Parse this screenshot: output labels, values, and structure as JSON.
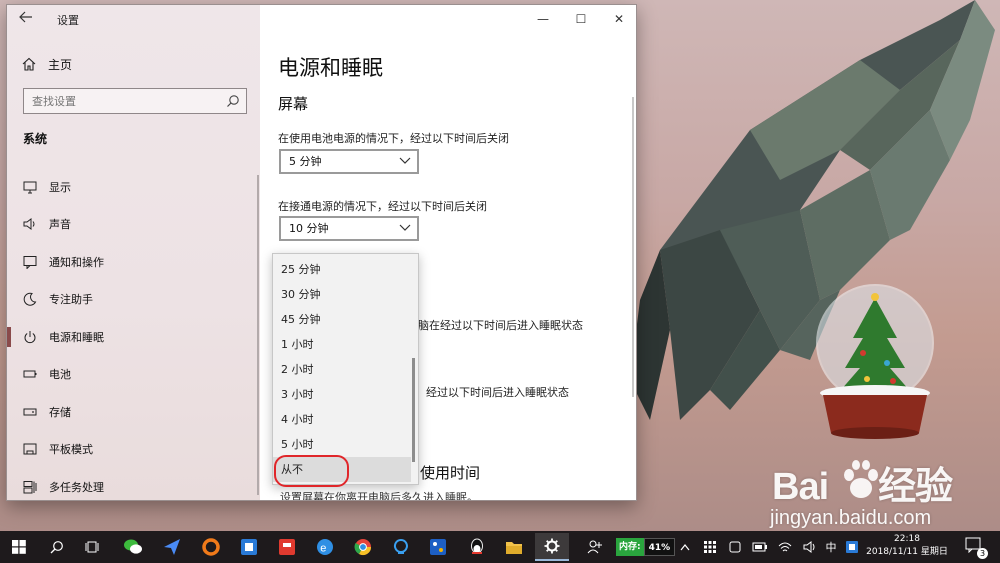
{
  "window": {
    "title": "设置",
    "controls": {
      "minimize": "—",
      "maximize": "☐",
      "close": "✕"
    }
  },
  "sidebar": {
    "home_label": "主页",
    "search_placeholder": "查找设置",
    "section_title": "系统",
    "items": [
      {
        "label": "显示",
        "icon": "monitor-icon"
      },
      {
        "label": "声音",
        "icon": "speaker-icon"
      },
      {
        "label": "通知和操作",
        "icon": "notification-icon"
      },
      {
        "label": "专注助手",
        "icon": "moon-icon"
      },
      {
        "label": "电源和睡眠",
        "icon": "power-icon",
        "active": true
      },
      {
        "label": "电池",
        "icon": "battery-icon"
      },
      {
        "label": "存储",
        "icon": "storage-icon"
      },
      {
        "label": "平板模式",
        "icon": "tablet-icon"
      },
      {
        "label": "多任务处理",
        "icon": "multitask-icon"
      }
    ]
  },
  "content": {
    "page_title": "电源和睡眠",
    "screen_heading": "屏幕",
    "battery_label": "在使用电池电源的情况下，经过以下时间后关闭",
    "battery_value": "5 分钟",
    "plugged_label": "在接通电源的情况下，经过以下时间后关闭",
    "plugged_value": "10 分钟",
    "sleep_partial_1": "脑在经过以下时间后进入睡眠状态",
    "sleep_partial_2": "经过以下时间后进入睡眠状态",
    "usage_heading": "使用时间",
    "bottom_desc": "设置屏幕在你离开电脑后多久进入睡眠。"
  },
  "dropdown": {
    "options": [
      "25 分钟",
      "30 分钟",
      "45 分钟",
      "1 小时",
      "2 小时",
      "3 小时",
      "4 小时",
      "5 小时",
      "从不"
    ],
    "selected": "从不",
    "highlight_color": "#e0262a"
  },
  "taskbar": {
    "memory_label": "内存:",
    "memory_value": "41%",
    "ime": "中",
    "time": "22:18",
    "date": "2018/11/11 星期日",
    "notification_count": "3"
  },
  "watermark": {
    "logo_text": "Bai",
    "logo_suffix": "经验",
    "url": "jingyan.baidu.com"
  }
}
